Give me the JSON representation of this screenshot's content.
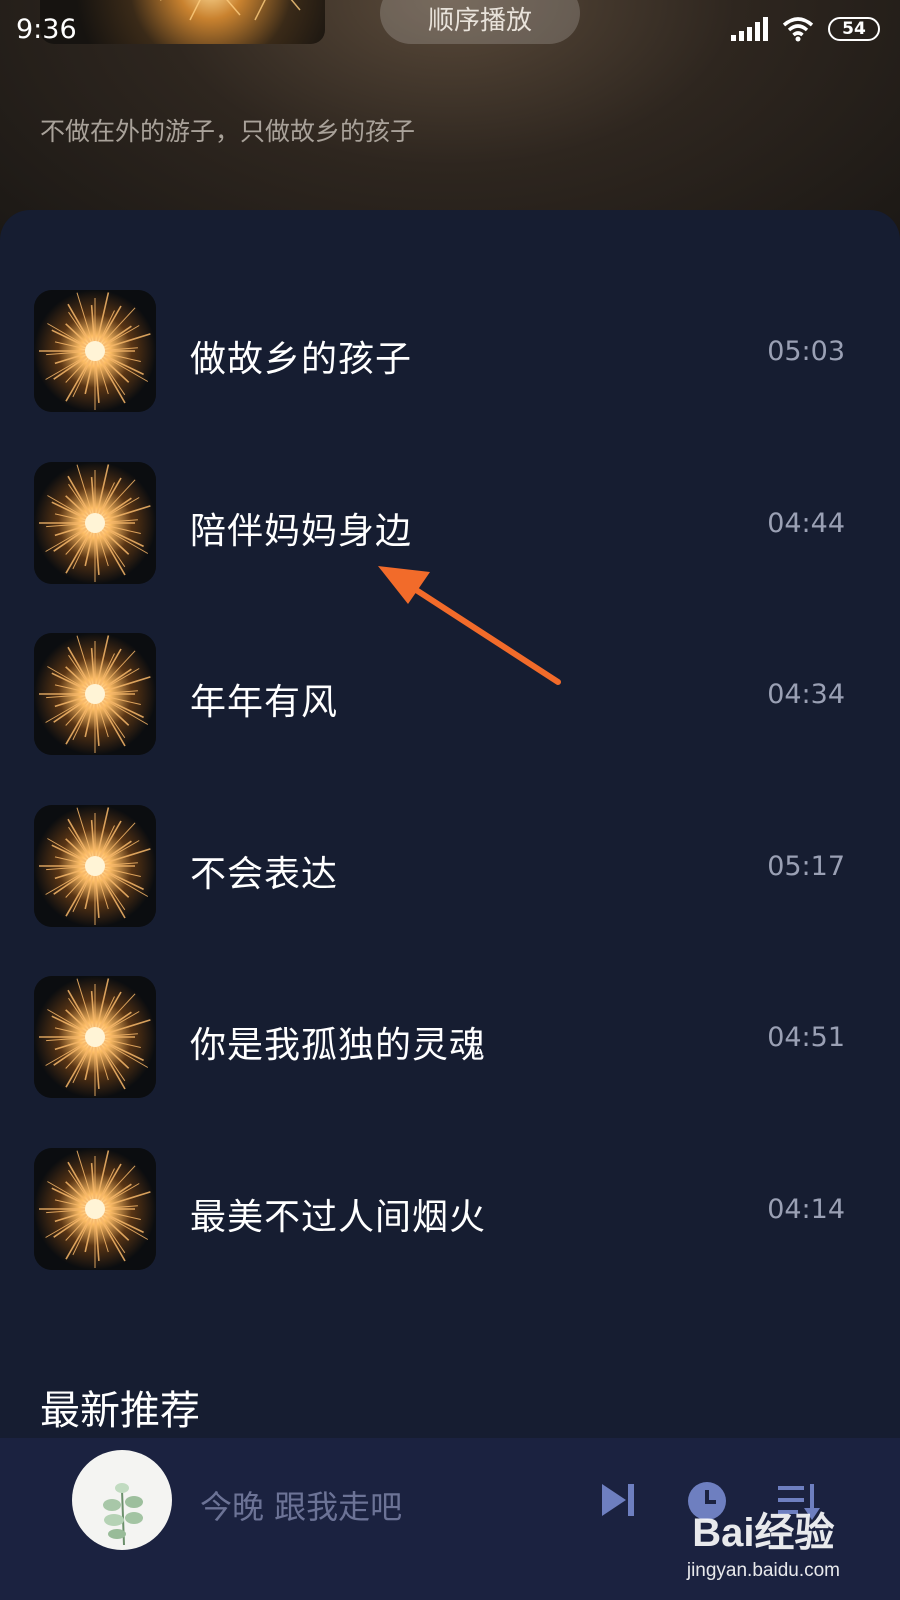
{
  "status_bar": {
    "time": "9:36",
    "battery": "54"
  },
  "header": {
    "play_order_label": "顺序播放",
    "subtitle": "不做在外的游子，只做故乡的孩子"
  },
  "songs": [
    {
      "title": "做故乡的孩子",
      "duration": "05:03"
    },
    {
      "title": "陪伴妈妈身边",
      "duration": "04:44"
    },
    {
      "title": "年年有风",
      "duration": "04:34"
    },
    {
      "title": "不会表达",
      "duration": "05:17"
    },
    {
      "title": "你是我孤独的灵魂",
      "duration": "04:51"
    },
    {
      "title": "最美不过人间烟火",
      "duration": "04:14"
    }
  ],
  "section": {
    "title": "最新推荐"
  },
  "player": {
    "now_playing": "今晚 跟我走吧"
  },
  "watermark": {
    "brand": "Bai经验",
    "url": "jingyan.baidu.com"
  },
  "colors": {
    "accent_arrow": "#f26b2a",
    "panel_bg": "#161d31",
    "player_bg": "#1b2240"
  },
  "icons": [
    "signal-icon",
    "wifi-icon",
    "battery-icon",
    "next-icon",
    "timer-icon",
    "playlist-icon",
    "annotation-arrow"
  ]
}
